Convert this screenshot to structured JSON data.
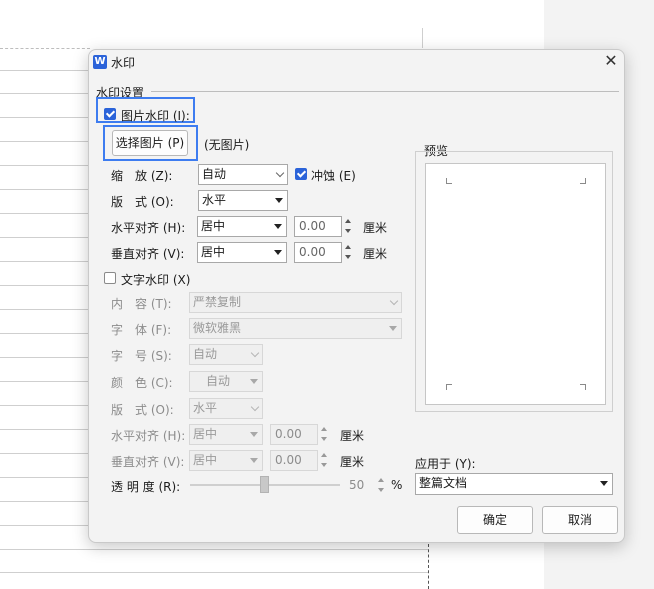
{
  "dialog": {
    "title": "水印",
    "title_logo": "W",
    "close_glyph": "✕",
    "section_label": "水印设置",
    "picture_watermark": {
      "checkbox_label": "图片水印 (I):",
      "checked": true,
      "select_button": "选择图片 (P)",
      "no_picture": "(无图片)",
      "scale_label": "缩　放 (Z):",
      "scale_value": "自动",
      "washout_label": "冲蚀 (E)",
      "washout_checked": true,
      "layout_label": "版　式 (O):",
      "layout_value": "水平",
      "halign_label": "水平对齐 (H):",
      "halign_value": "居中",
      "halign_offset": "0.00",
      "valign_label": "垂直对齐 (V):",
      "valign_value": "居中",
      "valign_offset": "0.00",
      "unit": "厘米"
    },
    "text_watermark": {
      "checkbox_label": "文字水印 (X)",
      "checked": false,
      "content_label": "内　容 (T):",
      "content_value": "严禁复制",
      "font_label": "字　体 (F):",
      "font_value": "微软雅黑",
      "size_label": "字　号 (S):",
      "size_value": "自动",
      "color_label": "颜　色 (C):",
      "color_value": "自动",
      "layout_label": "版　式 (O):",
      "layout_value": "水平",
      "halign_label": "水平对齐 (H):",
      "halign_value": "居中",
      "halign_offset": "0.00",
      "valign_label": "垂直对齐 (V):",
      "valign_value": "居中",
      "valign_offset": "0.00",
      "unit": "厘米",
      "transparency_label": "透 明 度 (R):",
      "transparency_value": "50",
      "transparency_unit": "%"
    },
    "preview_label": "预览",
    "apply_to_label": "应用于 (Y):",
    "apply_to_value": "整篇文档",
    "ok_button": "确定",
    "cancel_button": "取消"
  },
  "colors": {
    "accent": "#2b63d9",
    "highlight": "#3d7cf0"
  }
}
